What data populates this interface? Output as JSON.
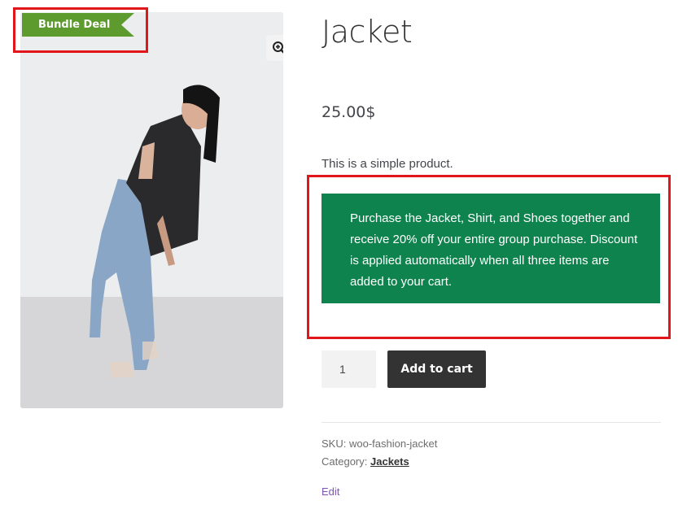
{
  "product": {
    "title": "Jacket",
    "price": "25.00$",
    "short_description": "This is a simple product.",
    "badge": "Bundle Deal",
    "bundle_notice": "Purchase the Jacket, Shirt, and Shoes together and receive 20% off your entire group purchase. Discount is applied automatically when all three items are added to your cart.",
    "quantity": "1",
    "add_to_cart_label": "Add to cart",
    "sku_label": "SKU:",
    "sku": "woo-fashion-jacket",
    "category_label": "Category:",
    "category": "Jackets",
    "edit_label": "Edit"
  },
  "icons": {
    "zoom": "zoom-in-icon"
  },
  "colors": {
    "badge_green": "#5e9b2f",
    "notice_green": "#0f834d",
    "highlight_red": "#e0161b",
    "button_dark": "#333333",
    "edit_purple": "#7f54b3"
  }
}
